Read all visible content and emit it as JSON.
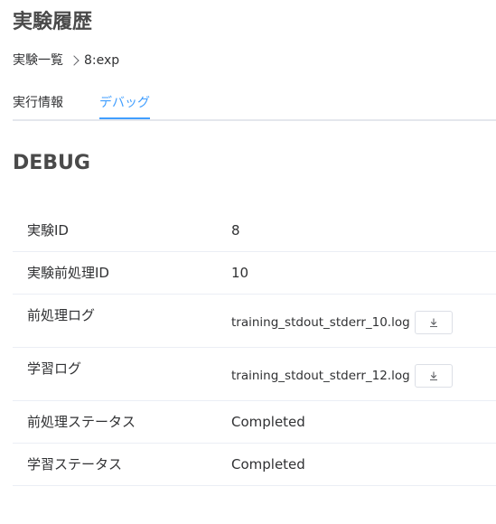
{
  "page": {
    "title": "実験履歴"
  },
  "breadcrumb": {
    "parent": "実験一覧",
    "current": "8:exp"
  },
  "tabs": [
    {
      "label": "実行情報",
      "active": false
    },
    {
      "label": "デバッグ",
      "active": true
    }
  ],
  "colors": {
    "accent": "#409eff",
    "divider": "#ebeef5"
  },
  "debug": {
    "title": "DEBUG",
    "rows": [
      {
        "label": "実験ID",
        "value": "8"
      },
      {
        "label": "実験前処理ID",
        "value": "10"
      },
      {
        "label": "前処理ログ",
        "value": "training_stdout_stderr_10.log",
        "icon": "download-icon"
      },
      {
        "label": "学習ログ",
        "value": "training_stdout_stderr_12.log",
        "icon": "download-icon"
      },
      {
        "label": "前処理ステータス",
        "value": "Completed"
      },
      {
        "label": "学習ステータス",
        "value": "Completed"
      }
    ]
  }
}
